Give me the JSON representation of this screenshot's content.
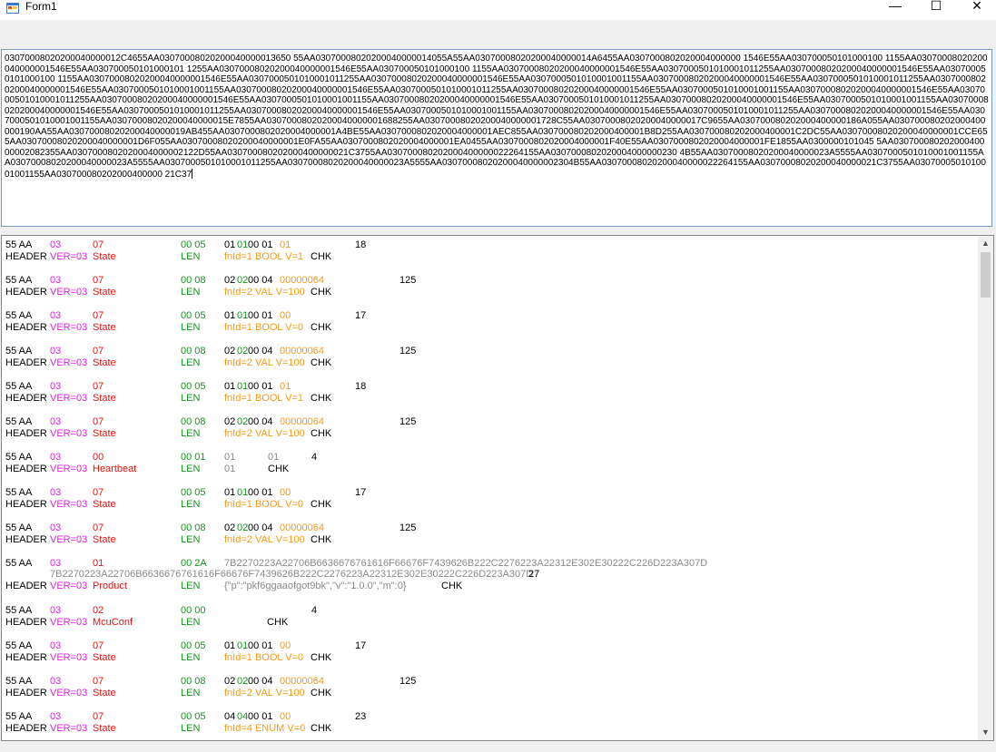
{
  "window": {
    "title": "Form1",
    "minimize": "—",
    "maximize": "☐",
    "close": "✕"
  },
  "hex_input": "03070008020200040000012C4655AA03070008020200040000013650 55AA03070008020200040000014055A55AA03070008020200040000014A6455AA0307000802020004000000 1546E55AA030700050101000100 1155AA03070008020200040000001546E55AA030700050101000101 1255AA03070008020200040000001546E55AA030700050101000100 1155AA03070008020200040000001546E55AA0307000501010001011255AA03070008020200040000001546E55AA030700050101000100 1155AA03070008020200040000001546E55AA0307000501010001011255AA03070008020200040000001546E55AA0307000501010001001155AA03070008020200040000001546E55AA0307000501010001011255AA03070008020200040000001546E55AA0307000501010001001155AA03070008020200040000001546E55AA0307000501010001011255AA03070008020200040000001546E55AA0307000501010001001155AA03070008020200040000001546E55AA0307000501010001011255AA03070008020200040000001546E55AA0307000501010001001155AA03070008020200040000001546E55AA0307000501010001011255AA03070008020200040000001546E55AA0307000501010001001155AA03070008020200040000001546E55AA0307000501010001011255AA03070008020200040000001546E55AA0307000501010001001155AA03070008020200040000001546E55AA0307000501010001011255AA03070008020200040000001546E55AA0307000501010001001155AA03070008020200040000015E7855AA03070008020200040000001688255AA03070008020200040000001728C55AA03070008020200040000017C9655AA030700080202000400000186A055AA030700080202000400000190AA55AA03070008020200040000019AB455AA0307000802020004000001A4BE55AA0307000802020004000001AEC855AA030700080202000400001B8D255AA030700080202000400001C2DC55AA03070008020200040000001CCE655AA03070008020200040000001D6F055AA03070008020200040000001E0FA55AA0307000802020004000001EA0455AA0307000802020004000001F40E55AA0307000802020004000001FE1855AA0300000101045 5AA03070008020200040000002082355AA0307000802020004000002122D55AA030700080202000400000021C3755AA030700080202000400000022264155AA0307000802020004000000230 4B55AA03070008020200040000023A5555AA0307000501010001001155AA03070008020200040000023A5555AA0307000501010001011255AA03070008020200040000023A5555AA03070008020200040000002304B55AA03070008020200040000022264155AA03070008020200040000021C3755AA0307000501010001001155AA030700080202000400000 21C37",
  "log": [
    {
      "header": "55 AA",
      "ver": "03",
      "cmd": "07",
      "len": "00 05",
      "data": [
        "01 ",
        "01",
        " 00 01 ",
        "01"
      ],
      "num": "18",
      "cap_header": "HEADER",
      "cap_ver": "VER=03",
      "cap_cmd": "State",
      "cap_len": "LEN",
      "cap_data": "fnId=1 BOOL V=1",
      "cap_chk": "CHK"
    },
    {
      "header": "55 AA",
      "ver": "03",
      "cmd": "07",
      "len": "00 08",
      "data": [
        "02 ",
        "02",
        " 00 04 ",
        "00000064"
      ],
      "num": "125",
      "cap_header": "HEADER",
      "cap_ver": "VER=03",
      "cap_cmd": "State",
      "cap_len": "LEN",
      "cap_data": "fnId=2 VAL V=100",
      "cap_chk": "CHK"
    },
    {
      "header": "55 AA",
      "ver": "03",
      "cmd": "07",
      "len": "00 05",
      "data": [
        "01 ",
        "01",
        " 00 01 ",
        "00"
      ],
      "num": "17",
      "cap_header": "HEADER",
      "cap_ver": "VER=03",
      "cap_cmd": "State",
      "cap_len": "LEN",
      "cap_data": "fnId=1 BOOL V=0",
      "cap_chk": "CHK"
    },
    {
      "header": "55 AA",
      "ver": "03",
      "cmd": "07",
      "len": "00 08",
      "data": [
        "02 ",
        "02",
        " 00 04 ",
        "00000064"
      ],
      "num": "125",
      "cap_header": "HEADER",
      "cap_ver": "VER=03",
      "cap_cmd": "State",
      "cap_len": "LEN",
      "cap_data": "fnId=2 VAL V=100",
      "cap_chk": "CHK"
    },
    {
      "header": "55 AA",
      "ver": "03",
      "cmd": "07",
      "len": "00 05",
      "data": [
        "01 ",
        "01",
        " 00 01 ",
        "01"
      ],
      "num": "18",
      "cap_header": "HEADER",
      "cap_ver": "VER=03",
      "cap_cmd": "State",
      "cap_len": "LEN",
      "cap_data": "fnId=1 BOOL V=1",
      "cap_chk": "CHK"
    },
    {
      "header": "55 AA",
      "ver": "03",
      "cmd": "07",
      "len": "00 08",
      "data": [
        "02 ",
        "02",
        " 00 04 ",
        "00000064"
      ],
      "num": "125",
      "cap_header": "HEADER",
      "cap_ver": "VER=03",
      "cap_cmd": "State",
      "cap_len": "LEN",
      "cap_data": "fnId=2 VAL V=100",
      "cap_chk": "CHK"
    },
    {
      "header": "55 AA",
      "ver": "03",
      "cmd": "00",
      "len": "00 01",
      "data": [
        "01",
        "",
        "",
        ""
      ],
      "data2": "01",
      "num": "4",
      "cap_header": "HEADER",
      "cap_ver": "VER=03",
      "cap_cmd": "Heartbeat",
      "cap_len": "LEN",
      "cap_data": "01",
      "cap_chk": "CHK",
      "heartbeat": true
    },
    {
      "header": "55 AA",
      "ver": "03",
      "cmd": "07",
      "len": "00 05",
      "data": [
        "01 ",
        "01",
        " 00 01 ",
        "00"
      ],
      "num": "17",
      "cap_header": "HEADER",
      "cap_ver": "VER=03",
      "cap_cmd": "State",
      "cap_len": "LEN",
      "cap_data": "fnId=1 BOOL V=0",
      "cap_chk": "CHK"
    },
    {
      "header": "55 AA",
      "ver": "03",
      "cmd": "07",
      "len": "00 08",
      "data": [
        "02 ",
        "02",
        " 00 04 ",
        "00000064"
      ],
      "num": "125",
      "cap_header": "HEADER",
      "cap_ver": "VER=03",
      "cap_cmd": "State",
      "cap_len": "LEN",
      "cap_data": "fnId=2 VAL V=100",
      "cap_chk": "CHK"
    }
  ],
  "product_entry": {
    "header": "55 AA",
    "ver": "03",
    "cmd": "01",
    "len": "00 2A",
    "data": "7B2270223A22706B6636676761616F66676F7439626B222C2276223A22312E302E30222C226D223A307D",
    "data_wrap": "7B2270223A22706B6636676761616F66676F7439626B222C2276223A22312E302E30222C226D223A307D",
    "num": "27",
    "cap_header": "HEADER",
    "cap_ver": "VER=03",
    "cap_cmd": "Product",
    "cap_len": "LEN",
    "cap_data": "{\"p\":\"pkf6ggaaofgot9bk\",\"v\":\"1.0.0\",\"m\":0}",
    "cap_chk": "CHK"
  },
  "mcuconf_entry": {
    "header": "55 AA",
    "ver": "03",
    "cmd": "02",
    "len": "00 00",
    "num": "4",
    "cap_header": "HEADER",
    "cap_ver": "VER=03",
    "cap_cmd": "McuConf",
    "cap_len": "LEN",
    "cap_chk": "CHK"
  },
  "tail": [
    {
      "header": "55 AA",
      "ver": "03",
      "cmd": "07",
      "len": "00 05",
      "data": [
        "01 ",
        "01",
        " 00 01 ",
        "00"
      ],
      "num": "17",
      "cap_header": "HEADER",
      "cap_ver": "VER=03",
      "cap_cmd": "State",
      "cap_len": "LEN",
      "cap_data": "fnId=1 BOOL V=0",
      "cap_chk": "CHK"
    },
    {
      "header": "55 AA",
      "ver": "03",
      "cmd": "07",
      "len": "00 08",
      "data": [
        "02 ",
        "02",
        " 00 04 ",
        "00000064"
      ],
      "num": "125",
      "cap_header": "HEADER",
      "cap_ver": "VER=03",
      "cap_cmd": "State",
      "cap_len": "LEN",
      "cap_data": "fnId=2 VAL V=100",
      "cap_chk": "CHK"
    },
    {
      "header": "55 AA",
      "ver": "03",
      "cmd": "07",
      "len": "00 05",
      "data": [
        "04 ",
        "04",
        " 00 01 ",
        "00"
      ],
      "num": "23",
      "cap_header": "HEADER",
      "cap_ver": "VER=03",
      "cap_cmd": "State",
      "cap_len": "LEN",
      "cap_data": "fnId=4 ENUM V=0",
      "cap_chk": "CHK"
    }
  ],
  "scroll": {
    "up": "▲",
    "down": "▼"
  }
}
